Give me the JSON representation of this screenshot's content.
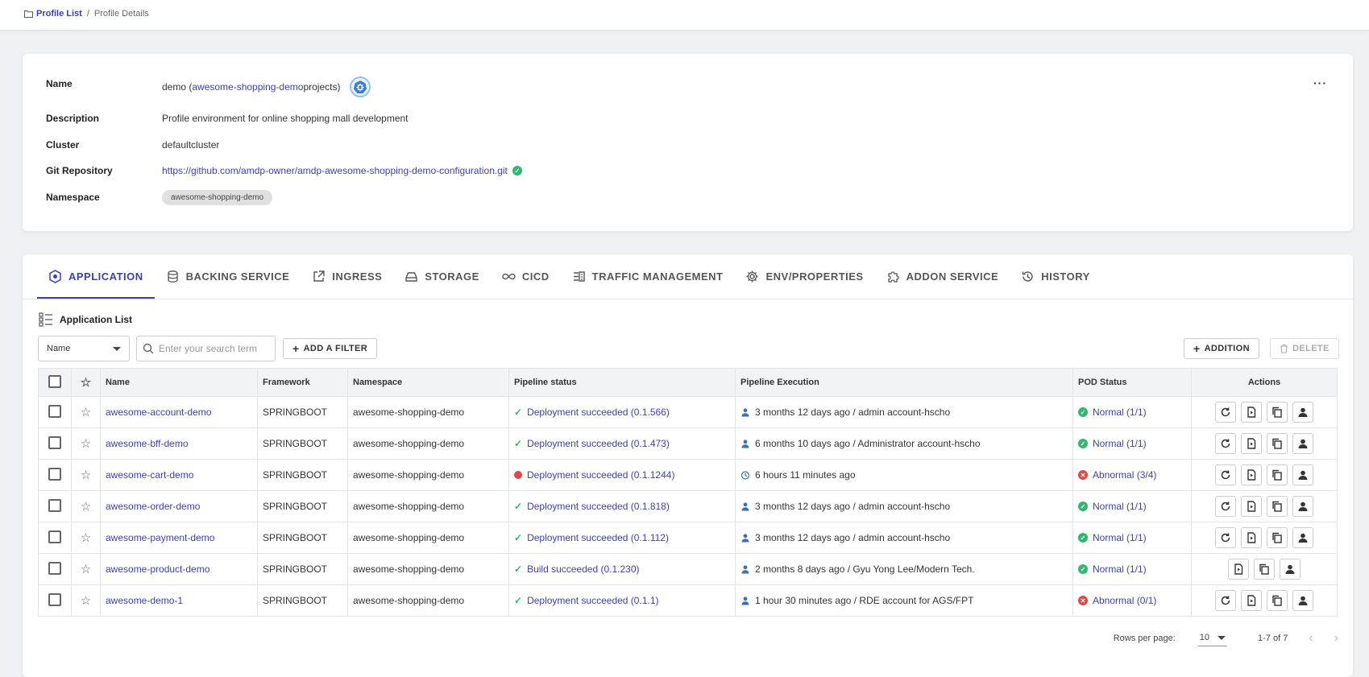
{
  "breadcrumb": {
    "root": "Profile List",
    "separator": "/",
    "current": "Profile Details"
  },
  "profile": {
    "labels": {
      "name": "Name",
      "description": "Description",
      "cluster": "Cluster",
      "git": "Git Repository",
      "namespace": "Namespace"
    },
    "name_prefix": "demo (",
    "name_link": "awesome-shopping-demo",
    "name_suffix": "projects)",
    "description": "Profile environment for online shopping mall development",
    "cluster": "defaultcluster",
    "git_url": "https://github.com/amdp-owner/amdp-awesome-shopping-demo-configuration.git",
    "namespace": "awesome-shopping-demo",
    "more": "···"
  },
  "tabs": [
    {
      "label": "APPLICATION",
      "icon": "application-icon",
      "active": true
    },
    {
      "label": "BACKING SERVICE",
      "icon": "database-icon"
    },
    {
      "label": "INGRESS",
      "icon": "external-link-icon"
    },
    {
      "label": "STORAGE",
      "icon": "storage-icon"
    },
    {
      "label": "CICD",
      "icon": "infinity-icon"
    },
    {
      "label": "TRAFFIC MANAGEMENT",
      "icon": "traffic-icon"
    },
    {
      "label": "ENV/PROPERTIES",
      "icon": "gear-icon"
    },
    {
      "label": "ADDON SERVICE",
      "icon": "puzzle-icon"
    },
    {
      "label": "HISTORY",
      "icon": "history-icon"
    }
  ],
  "list": {
    "title": "Application List",
    "filter_select": "Name",
    "search_placeholder": "Enter your search term",
    "add_filter": "ADD A FILTER",
    "addition": "ADDITION",
    "delete": "DELETE"
  },
  "table": {
    "headers": {
      "name": "Name",
      "framework": "Framework",
      "namespace": "Namespace",
      "pipeline_status": "Pipeline status",
      "pipeline_execution": "Pipeline Execution",
      "pod_status": "POD Status",
      "actions": "Actions"
    },
    "rows": [
      {
        "name": "awesome-account-demo",
        "framework": "SPRINGBOOT",
        "namespace": "awesome-shopping-demo",
        "status": "Deployment succeeded (0.1.566)",
        "status_icon": "check",
        "execution": "3 months 12 days ago / admin account-hscho",
        "exec_icon": "user",
        "pod": "Normal (1/1)",
        "pod_ok": true,
        "actions": [
          "refresh",
          "deploy",
          "copy",
          "user"
        ]
      },
      {
        "name": "awesome-bff-demo",
        "framework": "SPRINGBOOT",
        "namespace": "awesome-shopping-demo",
        "status": "Deployment succeeded (0.1.473)",
        "status_icon": "check",
        "execution": "6 months 10 days ago / Administrator account-hscho",
        "exec_icon": "user",
        "pod": "Normal (1/1)",
        "pod_ok": true,
        "actions": [
          "refresh",
          "deploy",
          "copy",
          "user"
        ]
      },
      {
        "name": "awesome-cart-demo",
        "framework": "SPRINGBOOT",
        "namespace": "awesome-shopping-demo",
        "status": "Deployment succeeded (0.1.1244)",
        "status_icon": "bug",
        "execution": "6 hours 11 minutes ago",
        "exec_icon": "clock",
        "pod": "Abnormal (3/4)",
        "pod_ok": false,
        "actions": [
          "refresh",
          "deploy",
          "copy",
          "user"
        ]
      },
      {
        "name": "awesome-order-demo",
        "framework": "SPRINGBOOT",
        "namespace": "awesome-shopping-demo",
        "status": "Deployment succeeded (0.1.818)",
        "status_icon": "check",
        "execution": "3 months 12 days ago / admin account-hscho",
        "exec_icon": "user",
        "pod": "Normal (1/1)",
        "pod_ok": true,
        "actions": [
          "refresh",
          "deploy",
          "copy",
          "user"
        ]
      },
      {
        "name": "awesome-payment-demo",
        "framework": "SPRINGBOOT",
        "namespace": "awesome-shopping-demo",
        "status": "Deployment succeeded (0.1.112)",
        "status_icon": "check",
        "execution": "3 months 12 days ago / admin account-hscho",
        "exec_icon": "user",
        "pod": "Normal (1/1)",
        "pod_ok": true,
        "actions": [
          "refresh",
          "deploy",
          "copy",
          "user"
        ]
      },
      {
        "name": "awesome-product-demo",
        "framework": "SPRINGBOOT",
        "namespace": "awesome-shopping-demo",
        "status": "Build succeeded (0.1.230)",
        "status_icon": "check",
        "execution": "2 months 8 days ago / Gyu Yong Lee/Modern Tech.",
        "exec_icon": "user",
        "pod": "Normal (1/1)",
        "pod_ok": true,
        "actions": [
          "deploy",
          "copy",
          "user"
        ]
      },
      {
        "name": "awesome-demo-1",
        "framework": "SPRINGBOOT",
        "namespace": "awesome-shopping-demo",
        "status": "Deployment succeeded (0.1.1)",
        "status_icon": "check",
        "execution": "1 hour 30 minutes ago / RDE account for AGS/FPT",
        "exec_icon": "user",
        "pod": "Abnormal (0/1)",
        "pod_ok": false,
        "actions": [
          "refresh",
          "deploy",
          "copy",
          "user"
        ]
      }
    ]
  },
  "pager": {
    "rows_label": "Rows per page:",
    "rows_value": "10",
    "range": "1-7 of 7"
  },
  "colors": {
    "accent": "#3b3fb5",
    "ok": "#2eb872",
    "error": "#e04848"
  }
}
